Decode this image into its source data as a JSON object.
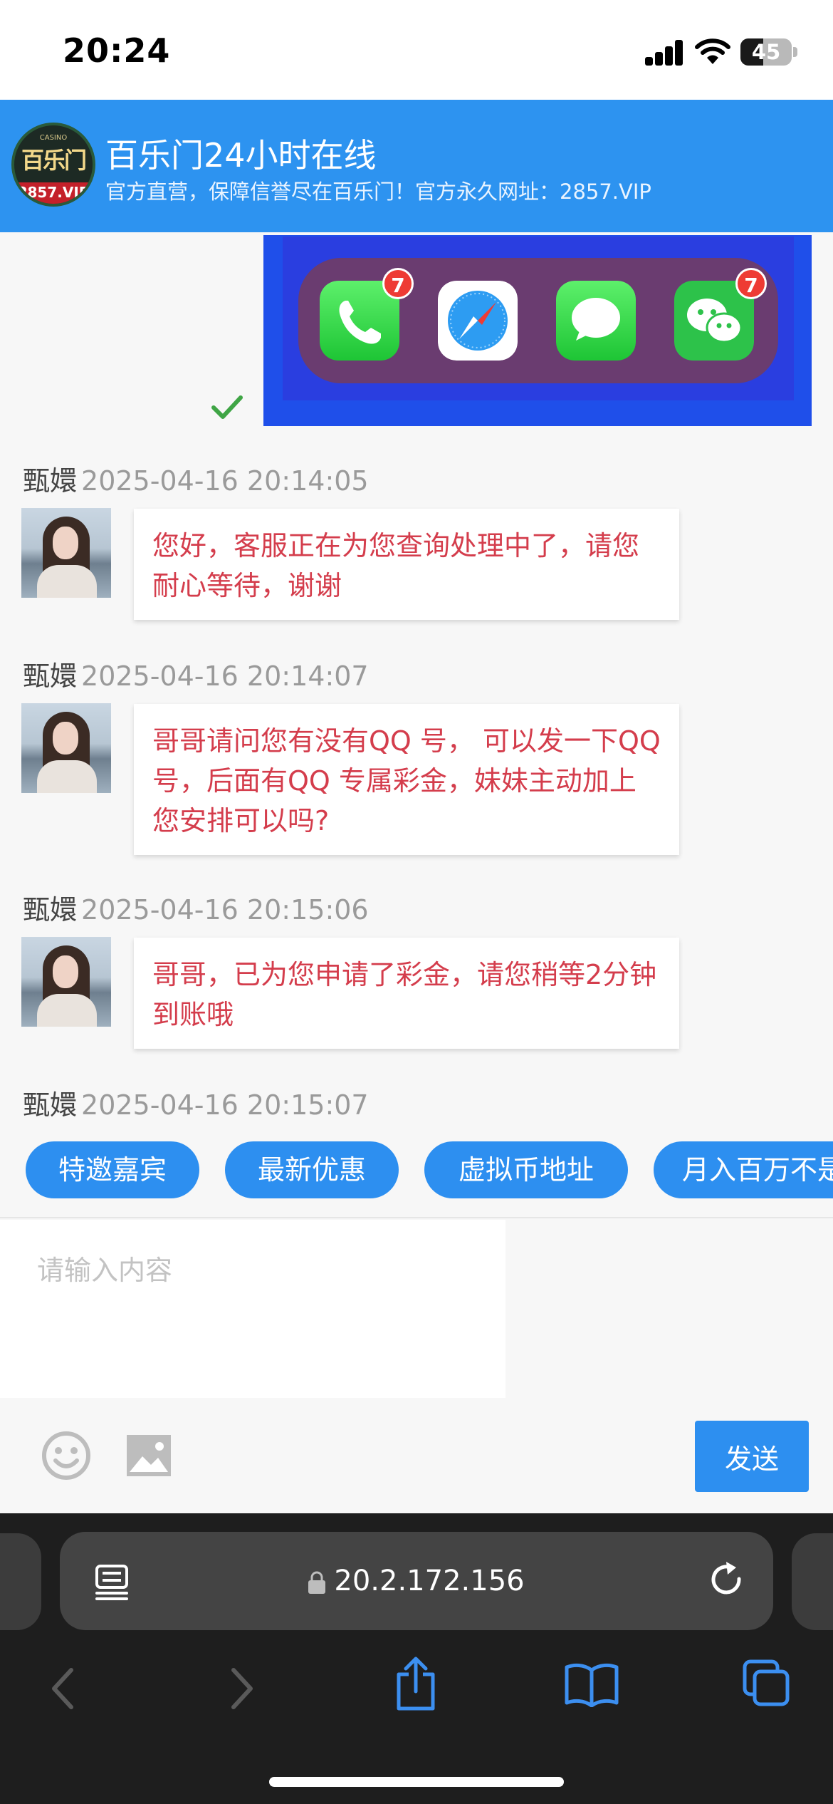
{
  "status_bar": {
    "time": "20:24",
    "battery": "45",
    "battery_level": 0.45
  },
  "header": {
    "logo": {
      "small_text": "CASINO",
      "name": "百乐门",
      "url": "2857.VIP"
    },
    "title": "百乐门24小时在线",
    "subtitle": "官方直营，保障信誉尽在百乐门！官方永久网址：2857.VIP"
  },
  "sent_image": {
    "badges": [
      "7",
      "7"
    ]
  },
  "messages": [
    {
      "sender": "甄嬛",
      "time": "2025-04-16 20:14:05",
      "text": "您好，客服正在为您查询处理中了，请您耐心等待，谢谢"
    },
    {
      "sender": "甄嬛",
      "time": "2025-04-16 20:14:07",
      "text": "哥哥请问您有没有QQ 号， 可以发一下QQ 号，后面有QQ 专属彩金，妹妹主动加上您安排可以吗?"
    },
    {
      "sender": "甄嬛",
      "time": "2025-04-16 20:15:06",
      "text": "哥哥，已为您申请了彩金，请您稍等2分钟到账哦"
    },
    {
      "sender": "甄嬛",
      "time": "2025-04-16 20:15:07"
    }
  ],
  "quick_replies": [
    "特邀嘉宾",
    "最新优惠",
    "虚拟币地址",
    "月入百万不是梦"
  ],
  "composer": {
    "placeholder": "请输入内容",
    "send_label": "发送"
  },
  "browser": {
    "url": "20.2.172.156"
  },
  "colors": {
    "header_blue": "#2d93f0",
    "message_red": "#d43d4c",
    "button_blue": "#2d8ff0"
  }
}
